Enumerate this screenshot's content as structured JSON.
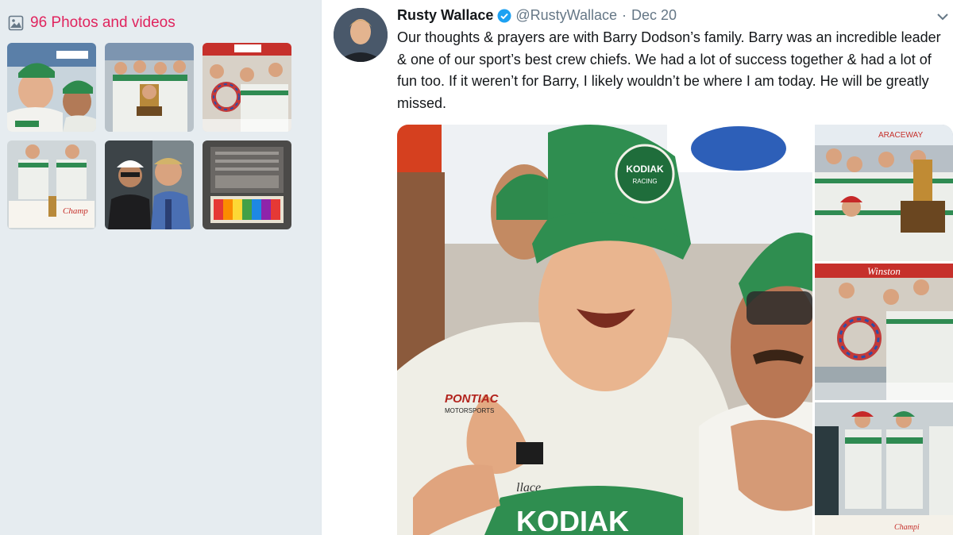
{
  "sidebar": {
    "media_count_label": "96 Photos and videos",
    "media_icon": "image-icon",
    "thumbnails": [
      {
        "name": "thumb-driver-crew-celebrating"
      },
      {
        "name": "thumb-victory-lane-trophy"
      },
      {
        "name": "thumb-team-celebration-wreath"
      },
      {
        "name": "thumb-champion-banner"
      },
      {
        "name": "thumb-selfie-two-men"
      },
      {
        "name": "thumb-made-in-japan-toy"
      }
    ]
  },
  "tweet": {
    "author_name": "Rusty Wallace",
    "handle": "@RustyWallace",
    "separator": "·",
    "date": "Dec 20",
    "verified_icon": "verified-badge-icon",
    "menu_icon": "chevron-down-icon",
    "text": "Our thoughts & prayers are with Barry Dodson’s family.  Barry was an incredible leader & one of our sport’s best crew chiefs.  We had a lot of success together & had a lot of fun too.  If it weren’t for Barry, I likely wouldn’t be where I am today.  He will be greatly missed.",
    "photo_text": {
      "cap_logo_line1": "KODIAK",
      "cap_logo_line2": "RACING",
      "sponsor_line1": "PONTIAC",
      "sponsor_line2": "MOTORSPORTS",
      "suit_text": "KODIAK",
      "name_patch": "llace",
      "banner_text": "Winston"
    }
  },
  "colors": {
    "sidebar_bg": "#e6ecf0",
    "accent": "#e0245e",
    "verified": "#1da1f2",
    "text_primary": "#14171a",
    "text_secondary": "#657786"
  }
}
